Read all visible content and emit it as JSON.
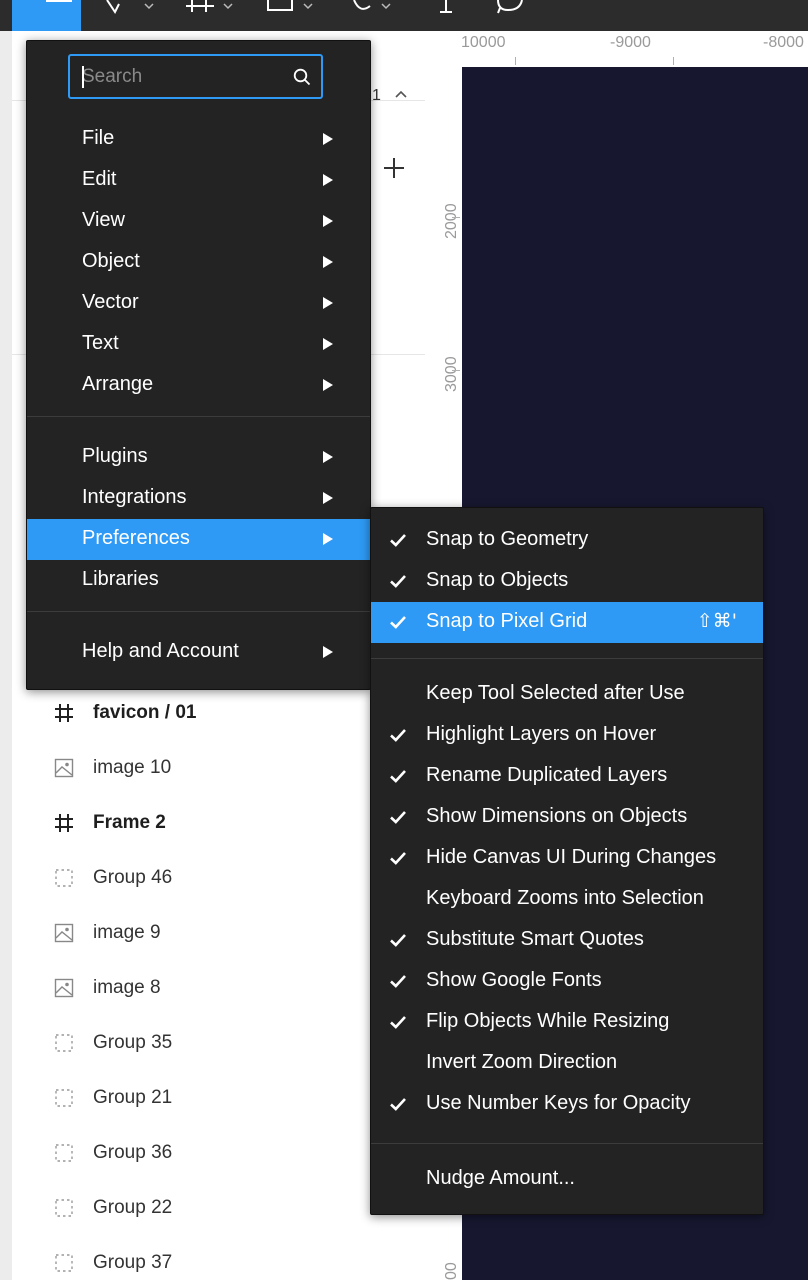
{
  "menu": {
    "search_placeholder": "Search",
    "groups": [
      [
        "File",
        "Edit",
        "View",
        "Object",
        "Vector",
        "Text",
        "Arrange"
      ],
      [
        "Plugins",
        "Integrations",
        "Preferences",
        "Libraries"
      ],
      [
        "Help and Account"
      ]
    ],
    "active_item": "Preferences"
  },
  "preferences_menu": {
    "items": [
      {
        "label": "Snap to Geometry",
        "checked": true
      },
      {
        "label": "Snap to Objects",
        "checked": true
      },
      {
        "label": "Snap to Pixel Grid",
        "checked": true,
        "shortcut": "⇧⌘'",
        "highlighted": true
      },
      {
        "label": "Keep Tool Selected after Use",
        "checked": false
      },
      {
        "label": "Highlight Layers on Hover",
        "checked": true
      },
      {
        "label": "Rename Duplicated Layers",
        "checked": true
      },
      {
        "label": "Show Dimensions on Objects",
        "checked": true
      },
      {
        "label": "Hide Canvas UI During Changes",
        "checked": true
      },
      {
        "label": "Keyboard Zooms into Selection",
        "checked": false
      },
      {
        "label": "Substitute Smart Quotes",
        "checked": true
      },
      {
        "label": "Show Google Fonts",
        "checked": true
      },
      {
        "label": "Flip Objects While Resizing",
        "checked": true
      },
      {
        "label": "Invert Zoom Direction",
        "checked": false
      },
      {
        "label": "Use Number Keys for Opacity",
        "checked": true
      },
      {
        "label": "Nudge Amount...",
        "checked": false
      }
    ]
  },
  "pages": {
    "current_page_fragment": "1"
  },
  "layers": [
    {
      "name": "favicon / 01",
      "type": "frame"
    },
    {
      "name": "image 10",
      "type": "image"
    },
    {
      "name": "Frame 2",
      "type": "frame"
    },
    {
      "name": "Group 46",
      "type": "group"
    },
    {
      "name": "image 9",
      "type": "image"
    },
    {
      "name": "image 8",
      "type": "image"
    },
    {
      "name": "Group 35",
      "type": "group"
    },
    {
      "name": "Group 21",
      "type": "group"
    },
    {
      "name": "Group 36",
      "type": "group"
    },
    {
      "name": "Group 22",
      "type": "group"
    },
    {
      "name": "Group 37",
      "type": "group"
    }
  ],
  "ruler": {
    "top_labels": [
      "10000",
      "-9000",
      "-8000"
    ],
    "left_labels": [
      "2000",
      "3000",
      "00",
      "00"
    ]
  },
  "colors": {
    "accent": "#2e9af5",
    "menu_bg": "#232323",
    "toolbar_bg": "#2c2c2c",
    "canvas_bg": "#171730"
  },
  "icons": {
    "menu_button": "hamburger-icon",
    "search": "search-icon",
    "submenu": "chevron-right-icon",
    "check": "check-icon",
    "frame_layer": "hash-frame-icon",
    "image_layer": "image-icon",
    "group_layer": "dashed-group-icon"
  }
}
